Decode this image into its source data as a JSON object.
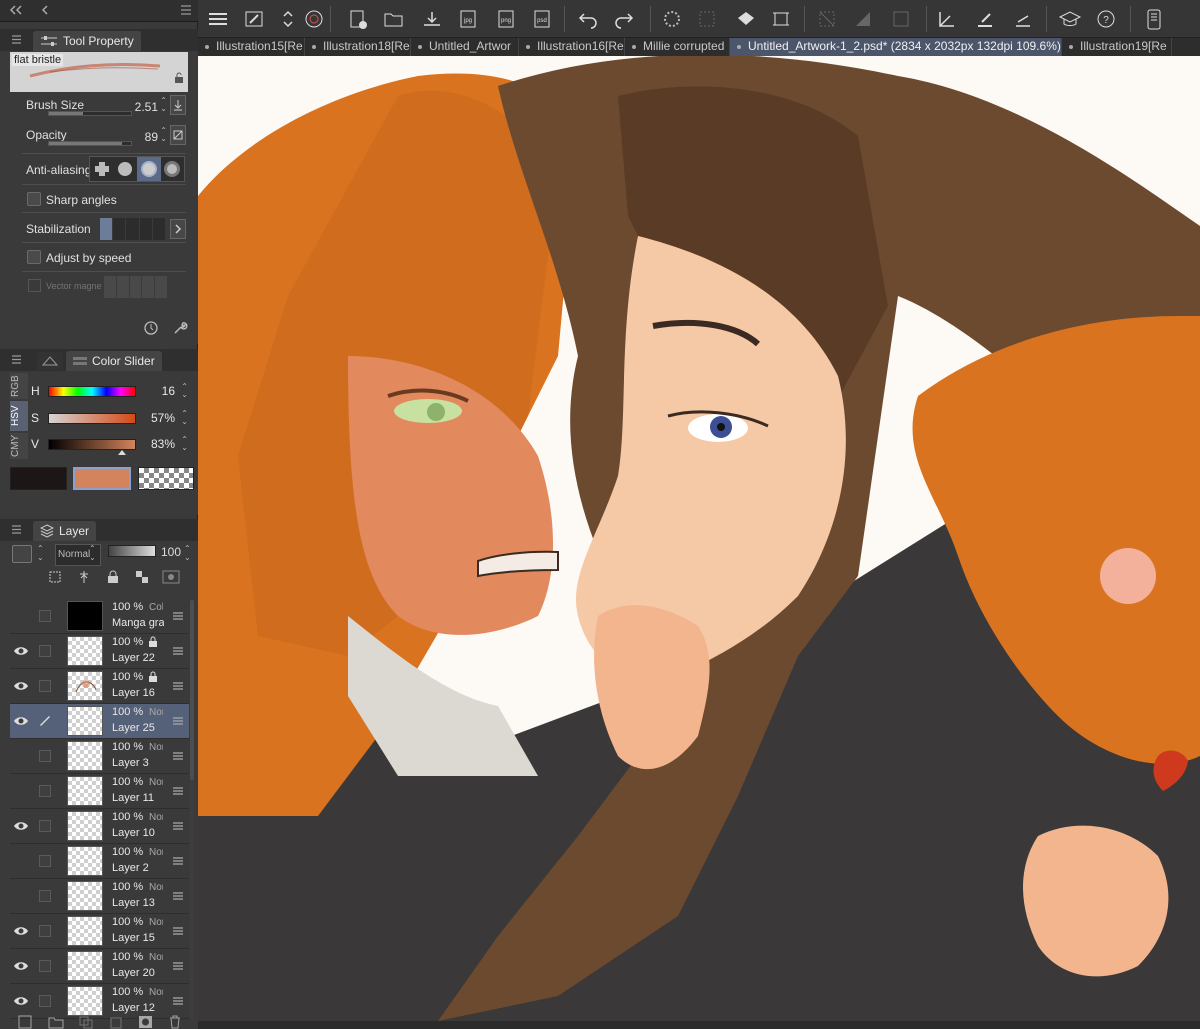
{
  "tool_property": {
    "tab_label": "Tool Property",
    "brush_name": "flat bristle",
    "brush_size_label": "Brush Size",
    "brush_size_value": "2.51",
    "opacity_label": "Opacity",
    "opacity_value": "89",
    "antialiasing_label": "Anti-aliasing",
    "sharp_angles_label": "Sharp angles",
    "stabilization_label": "Stabilization",
    "adjust_by_speed_label": "Adjust by speed",
    "vector_magnet_label": "Vector magnet"
  },
  "color_slider": {
    "tab_label": "Color Slider",
    "side_tabs": [
      "RGB",
      "HSV",
      "CMY"
    ],
    "h_label": "H",
    "h_value": "16",
    "s_label": "S",
    "s_value": "57%",
    "v_label": "V",
    "v_value": "83%",
    "main_color": "#1c1616",
    "sub_color": "#d4845c",
    "accent": "#4c566b"
  },
  "layer_panel": {
    "tab_label": "Layer",
    "blend_mode": "Normal",
    "opacity_value": "100",
    "layers": [
      {
        "pct": "100 %",
        "mode": "Color",
        "name": "Manga gradient",
        "visible": false,
        "locked": false,
        "thumb": "black"
      },
      {
        "pct": "100 %",
        "mode": "Normal",
        "name": "Layer 22",
        "visible": true,
        "locked": true,
        "thumb": "clear"
      },
      {
        "pct": "100 %",
        "mode": "Normal",
        "name": "Layer 16",
        "visible": true,
        "locked": true,
        "thumb": "sketch"
      },
      {
        "pct": "100 %",
        "mode": "Normal",
        "name": "Layer 25",
        "visible": true,
        "locked": false,
        "thumb": "clear",
        "selected": true
      },
      {
        "pct": "100 %",
        "mode": "Normal",
        "name": "Layer 3",
        "visible": false,
        "locked": false,
        "thumb": "clear"
      },
      {
        "pct": "100 %",
        "mode": "Normal",
        "name": "Layer 11",
        "visible": false,
        "locked": false,
        "thumb": "clear"
      },
      {
        "pct": "100 %",
        "mode": "Normal",
        "name": "Layer 10",
        "visible": true,
        "locked": false,
        "thumb": "clear"
      },
      {
        "pct": "100 %",
        "mode": "Normal",
        "name": "Layer 2",
        "visible": false,
        "locked": false,
        "thumb": "clear"
      },
      {
        "pct": "100 %",
        "mode": "Normal",
        "name": "Layer 13",
        "visible": false,
        "locked": false,
        "thumb": "clear"
      },
      {
        "pct": "100 %",
        "mode": "Normal",
        "name": "Layer 15",
        "visible": true,
        "locked": false,
        "thumb": "clear"
      },
      {
        "pct": "100 %",
        "mode": "Normal",
        "name": "Layer 20",
        "visible": true,
        "locked": false,
        "thumb": "clear"
      },
      {
        "pct": "100 %",
        "mode": "Normal",
        "name": "Layer 12",
        "visible": true,
        "locked": false,
        "thumb": "clear"
      }
    ]
  },
  "doc_tabs": [
    {
      "label": "Illustration15[Re"
    },
    {
      "label": "Illustration18[Re"
    },
    {
      "label": "Untitled_Artwor"
    },
    {
      "label": "Illustration16[Re"
    },
    {
      "label": "Millie corrupted"
    },
    {
      "label": "Untitled_Artwork-1_2.psd* (2834 x 2032px 132dpi 109.6%)",
      "active": true
    },
    {
      "label": "Illustration19[Re"
    }
  ],
  "toolbar_icons": [
    "menu-icon",
    "brush-settings-icon",
    "up-down-icon",
    "spiral-icon",
    "new-canvas-icon",
    "open-folder-icon",
    "save-icon",
    "export-jpg-icon",
    "export-png-icon",
    "export-psd-icon",
    "undo-icon",
    "redo-icon",
    "loading-icon",
    "select-dotted-icon",
    "fill-icon",
    "transform-icon",
    "deselect-icon",
    "invert-selection-icon",
    "crop-icon",
    "pen-check-icon",
    "brush-check-icon",
    "ruler-check-icon",
    "learn-icon",
    "help-icon",
    "tablet-icon"
  ]
}
